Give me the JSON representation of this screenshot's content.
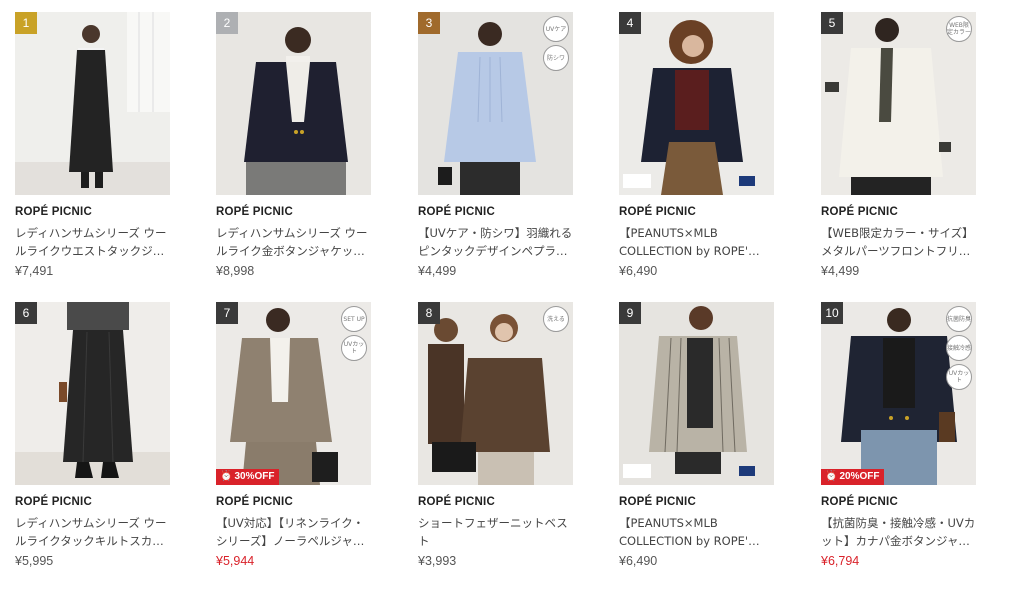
{
  "products": [
    {
      "rank": "1",
      "rank_style": "gold",
      "brand": "ROPÉ PICNIC",
      "title": "レディハンサムシリーズ ウールライクウエストタックジ…",
      "price": "¥7,491",
      "price_red": false,
      "badges": [],
      "sale": ""
    },
    {
      "rank": "2",
      "rank_style": "silver",
      "brand": "ROPÉ PICNIC",
      "title": "レディハンサムシリーズ ウールライク金ボタンジャケッ…",
      "price": "¥8,998",
      "price_red": false,
      "badges": [],
      "sale": ""
    },
    {
      "rank": "3",
      "rank_style": "bronze",
      "brand": "ROPÉ PICNIC",
      "title": "【UVケア・防シワ】羽織れるピンタックデザインペプラ…",
      "price": "¥4,499",
      "price_red": false,
      "badges": [
        "UVケア",
        "防シワ"
      ],
      "sale": ""
    },
    {
      "rank": "4",
      "rank_style": "plain",
      "brand": "ROPÉ PICNIC",
      "title": "【PEANUTS×MLB COLLECTION by ROPE'…",
      "price": "¥6,490",
      "price_red": false,
      "badges": [],
      "sale": ""
    },
    {
      "rank": "5",
      "rank_style": "plain",
      "brand": "ROPÉ PICNIC",
      "title": "【WEB限定カラー・サイズ】メタルパーツフロントフリ…",
      "price": "¥4,499",
      "price_red": false,
      "badges": [
        "WEB限定カラー"
      ],
      "sale": ""
    },
    {
      "rank": "6",
      "rank_style": "plain",
      "brand": "ROPÉ PICNIC",
      "title": "レディハンサムシリーズ ウールライクタックキルトスカ…",
      "price": "¥5,995",
      "price_red": false,
      "badges": [],
      "sale": ""
    },
    {
      "rank": "7",
      "rank_style": "plain",
      "brand": "ROPÉ PICNIC",
      "title": "【UV対応】【リネンライク・シリーズ】ノーラペルジャ…",
      "price": "¥5,944",
      "price_red": true,
      "badges": [
        "SET UP",
        "UVカット"
      ],
      "sale": "30%OFF"
    },
    {
      "rank": "8",
      "rank_style": "plain",
      "brand": "ROPÉ PICNIC",
      "title": "ショートフェザーニットベスト",
      "price": "¥3,993",
      "price_red": false,
      "badges": [
        "洗える"
      ],
      "sale": ""
    },
    {
      "rank": "9",
      "rank_style": "plain",
      "brand": "ROPÉ PICNIC",
      "title": "【PEANUTS×MLB COLLECTION by ROPE'…",
      "price": "¥6,490",
      "price_red": false,
      "badges": [],
      "sale": ""
    },
    {
      "rank": "10",
      "rank_style": "plain",
      "brand": "ROPÉ PICNIC",
      "title": "【抗菌防臭・接触冷感・UVカット】カナパ金ボタンジャ…",
      "price": "¥6,794",
      "price_red": true,
      "badges": [
        "抗菌防臭",
        "接触冷感",
        "UVカット"
      ],
      "sale": "20%OFF"
    }
  ],
  "colors": {
    "sale": "#d9222a",
    "gold": "#c9a227",
    "silver": "#aeb0b3",
    "bronze": "#a06a2c"
  }
}
